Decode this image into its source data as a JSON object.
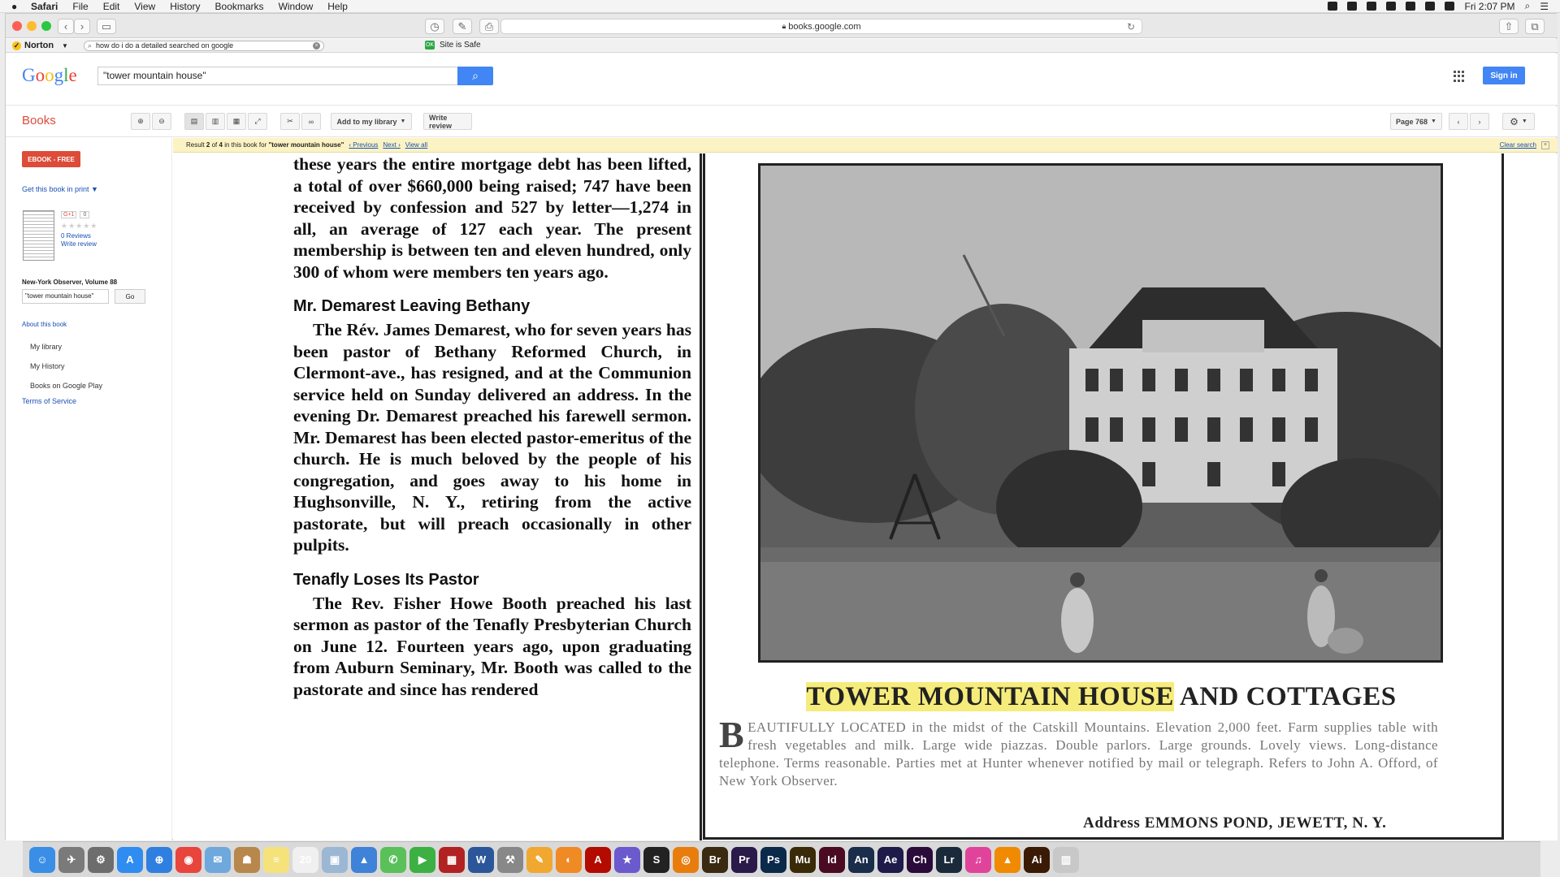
{
  "menubar": {
    "app": "Safari",
    "items": [
      "File",
      "Edit",
      "View",
      "History",
      "Bookmarks",
      "Window",
      "Help"
    ],
    "clock": "Fri 2:07 PM"
  },
  "browser": {
    "url": "books.google.com"
  },
  "norton": {
    "brand": "Norton",
    "search_value": "how do i do a detailed searched on google",
    "safe_label": "Site is Safe"
  },
  "google": {
    "logo": "Google",
    "search_value": "\"tower mountain house\"",
    "signin_label": "Sign in"
  },
  "books_toolbar": {
    "title": "Books",
    "add_library": "Add to my library",
    "write_review": "Write review",
    "page_label": "Page 768"
  },
  "sidebar": {
    "ebook_label": "EBOOK - FREE",
    "get_print": "Get this book in print ▼",
    "gplus_label": "G+1",
    "gplus_count": "0",
    "stars": "★★★★★",
    "reviews": "0 Reviews",
    "write_review": "Write review",
    "book_title": "New-York Observer, Volume 88",
    "inner_search": "\"tower mountain house\"",
    "go_label": "Go",
    "about": "About this book",
    "nav": [
      "My library",
      "My History",
      "Books on Google Play"
    ],
    "terms": "Terms of Service"
  },
  "result_bar": {
    "prefix": "Result",
    "current": "2",
    "of": "of",
    "total": "4",
    "middle": "in this book for",
    "query": "\"tower mountain house\"",
    "previous": "‹ Previous",
    "next": "Next ›",
    "view_all": "View all",
    "clear": "Clear search"
  },
  "page": {
    "para1": "these years the entire mortgage debt has been lifted, a total of over $660,000 being raised; 747 have been received by confession and 527 by letter—1,274 in all, an average of 127 each year. The present membership is between ten and eleven hundred, only 300 of whom were members ten years ago.",
    "heading1": "Mr. Demarest Leaving Bethany",
    "para2": "The Rév. James Demarest, who for seven years has been pastor of Bethany Reformed Church, in Clermont-ave., has resigned, and at the Communion service held on Sunday delivered an address. In the evening Dr. Demarest preached his farewell sermon. Mr. Demarest has been elected pastor-emeritus of the church. He is much beloved by the people of his congregation, and goes away to his home in Hughsonville, N. Y., retiring from the active pastorate, but will preach occasionally in other pulpits.",
    "heading2": "Tenafly Loses Its Pastor",
    "para3": "The Rev. Fisher Howe Booth preached his last sermon as pastor of the Tenafly Presbyterian Church on June 12. Fourteen years ago, upon graduating from Auburn Seminary, Mr. Booth was called to the pastorate and since has rendered",
    "ad_title_highlight": "TOWER MOUNTAIN HOUSE",
    "ad_title_rest": "AND COTTAGES",
    "ad_dropcap": "B",
    "ad_text": "EAUTIFULLY LOCATED in the midst of the Catskill Mountains. Elevation 2,000 feet. Farm supplies table with fresh vegetables and milk. Large wide piazzas. Double parlors. Large grounds. Lovely views. Long-distance telephone. Terms reasonable. Parties met at Hunter whenever notified by mail or telegraph. Refers to John A. Offord, of New York Observer.",
    "ad_address": "Address EMMONS POND, JEWETT, N. Y."
  },
  "dock": [
    {
      "name": "finder-icon",
      "color": "#3a8ee6",
      "glyph": "☺"
    },
    {
      "name": "launchpad-icon",
      "color": "#7a7a7a",
      "glyph": "✈"
    },
    {
      "name": "system-preferences-icon",
      "color": "#6d6d6d",
      "glyph": "⚙"
    },
    {
      "name": "app-store-icon",
      "color": "#2f8cf0",
      "glyph": "A"
    },
    {
      "name": "safari-icon",
      "color": "#2f7fe0",
      "glyph": "⊕"
    },
    {
      "name": "chrome-icon",
      "color": "#e8453c",
      "glyph": "◉"
    },
    {
      "name": "mail-icon",
      "color": "#6fa8dc",
      "glyph": "✉"
    },
    {
      "name": "contacts-icon",
      "color": "#b8874b",
      "glyph": "☗"
    },
    {
      "name": "notes-icon",
      "color": "#f5e27a",
      "glyph": "≡"
    },
    {
      "name": "calendar-icon",
      "color": "#f0f0f0",
      "glyph": "20"
    },
    {
      "name": "preview-icon",
      "color": "#9bb7d4",
      "glyph": "▣"
    },
    {
      "name": "keynote-icon",
      "color": "#3f83d8",
      "glyph": "▲"
    },
    {
      "name": "messages-icon",
      "color": "#5ac05a",
      "glyph": "✆"
    },
    {
      "name": "facetime-icon",
      "color": "#3cb043",
      "glyph": "▶"
    },
    {
      "name": "photo-booth-icon",
      "color": "#b22222",
      "glyph": "▦"
    },
    {
      "name": "word-icon",
      "color": "#2b579a",
      "glyph": "W"
    },
    {
      "name": "automator-icon",
      "color": "#888888",
      "glyph": "⚒"
    },
    {
      "name": "pages-icon",
      "color": "#f0a830",
      "glyph": "✎"
    },
    {
      "name": "ibooks-icon",
      "color": "#f08a24",
      "glyph": "◐"
    },
    {
      "name": "acrobat-icon",
      "color": "#b30b00",
      "glyph": "A"
    },
    {
      "name": "imovie-icon",
      "color": "#6a5acd",
      "glyph": "★"
    },
    {
      "name": "sonos-icon",
      "color": "#222222",
      "glyph": "S"
    },
    {
      "name": "blender-icon",
      "color": "#e87d0d",
      "glyph": "◎"
    },
    {
      "name": "bridge-icon",
      "color": "#3b2a12",
      "glyph": "Br"
    },
    {
      "name": "premiere-icon",
      "color": "#2a1a4a",
      "glyph": "Pr"
    },
    {
      "name": "photoshop-icon",
      "color": "#0b2a4a",
      "glyph": "Ps"
    },
    {
      "name": "muse-icon",
      "color": "#3a2a08",
      "glyph": "Mu"
    },
    {
      "name": "indesign-icon",
      "color": "#4a0b22",
      "glyph": "Id"
    },
    {
      "name": "animate-icon",
      "color": "#1a2d4a",
      "glyph": "An"
    },
    {
      "name": "after-effects-icon",
      "color": "#1e1a4a",
      "glyph": "Ae"
    },
    {
      "name": "character-animator-icon",
      "color": "#2a0b3a",
      "glyph": "Ch"
    },
    {
      "name": "lightroom-icon",
      "color": "#1a2a3a",
      "glyph": "Lr"
    },
    {
      "name": "itunes-icon",
      "color": "#e0449a",
      "glyph": "♫"
    },
    {
      "name": "vlc-icon",
      "color": "#f08a00",
      "glyph": "▲"
    },
    {
      "name": "illustrator-icon",
      "color": "#3a1a05",
      "glyph": "Ai"
    },
    {
      "name": "trash-icon",
      "color": "#c8c8c8",
      "glyph": "▥"
    }
  ]
}
